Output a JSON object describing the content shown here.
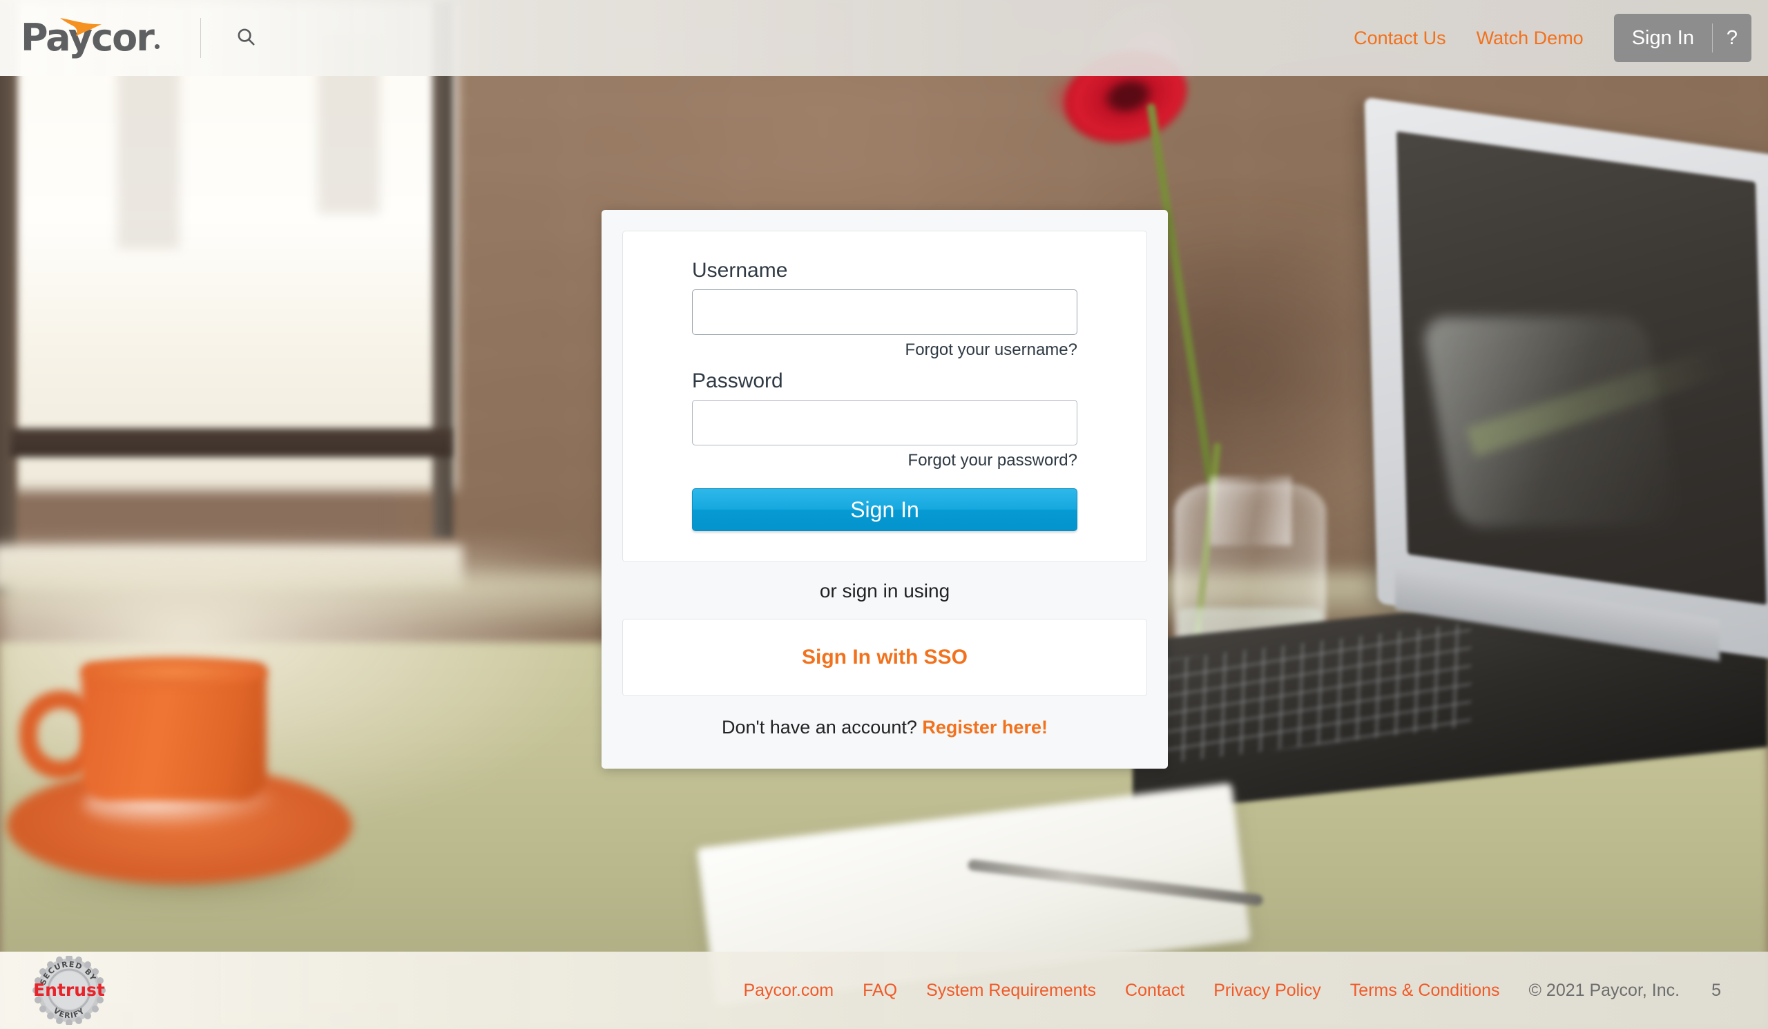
{
  "header": {
    "logo_text": "Paycor",
    "logo_icon": "paycor-arrow-icon",
    "search_icon": "search-icon",
    "links": [
      {
        "label": "Contact Us"
      },
      {
        "label": "Watch Demo"
      }
    ],
    "signin_button": "Sign In",
    "help_button": "?"
  },
  "login": {
    "username_label": "Username",
    "username_value": "",
    "username_placeholder": "",
    "forgot_username": "Forgot your username?",
    "password_label": "Password",
    "password_value": "",
    "password_placeholder": "",
    "forgot_password": "Forgot your password?",
    "signin_button": "Sign In",
    "or_text": "or sign in using",
    "sso_button": "Sign In with SSO",
    "register_prompt": "Don't have an account?",
    "register_link": "Register here!"
  },
  "footer": {
    "badge_icon": "entrust-secured-seal-icon",
    "badge_top_text": "SECURED BY",
    "badge_brand": "Entrust",
    "badge_bottom_text": "VERIFY",
    "links": [
      {
        "label": "Paycor.com"
      },
      {
        "label": "FAQ"
      },
      {
        "label": "System Requirements"
      },
      {
        "label": "Contact"
      },
      {
        "label": "Privacy Policy"
      },
      {
        "label": "Terms & Conditions"
      }
    ],
    "copyright": "© 2021 Paycor, Inc.",
    "page_number": "5"
  },
  "colors": {
    "brand_orange": "#f2711c",
    "footer_orange": "#f05a28",
    "signin_blue": "#16a8df",
    "logo_gray": "#5e5f61",
    "entrust_red": "#e8232a"
  },
  "background": {
    "description_icon": "desk-photo-background"
  }
}
